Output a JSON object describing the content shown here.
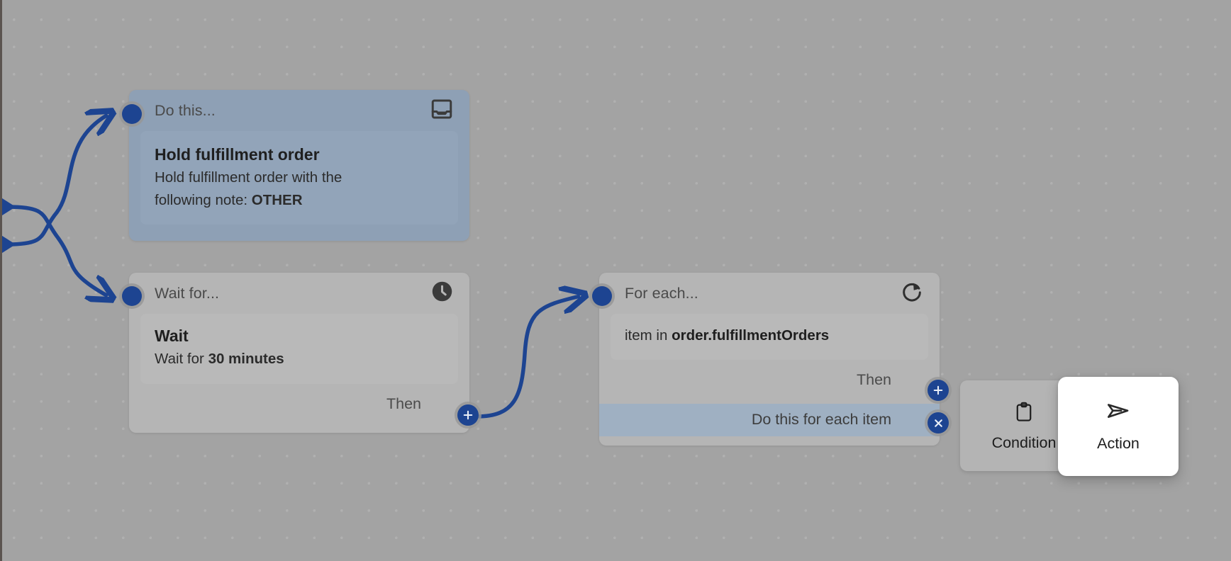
{
  "canvas": {
    "background_color": "#a3a3a3",
    "dot_color": "#b0b0b0",
    "accent_color": "#1d4491",
    "selected_node_color": "#8ea0b5"
  },
  "nodes": [
    {
      "id": "do-this",
      "header_label": "Do this...",
      "icon": "inbox-tray-icon",
      "body_title": "Hold fulfillment order",
      "body_line_1": "Hold fulfillment order with the",
      "body_line_2_prefix": "following note: ",
      "body_line_2_bold": "OTHER"
    },
    {
      "id": "wait-for",
      "header_label": "Wait for...",
      "icon": "clock-icon",
      "body_title": "Wait",
      "body_line_prefix": "Wait for ",
      "body_line_bold": "30 minutes",
      "then_label": "Then",
      "then_button_icon": "plus-icon"
    },
    {
      "id": "for-each",
      "header_label": "For each...",
      "icon": "loop-refresh-icon",
      "body_line_prefix": "item in ",
      "body_line_bold": "order.fulfillmentOrders",
      "then_label": "Then",
      "then_button_icon": "plus-icon",
      "do_each_label": "Do this for each item",
      "do_each_button_icon": "close-x-icon"
    }
  ],
  "popover": {
    "items": [
      {
        "label": "Condition",
        "icon": "clipboard-icon",
        "state": "normal"
      },
      {
        "label": "Action",
        "icon": "send-paper-plane-icon",
        "state": "highlighted"
      }
    ]
  }
}
